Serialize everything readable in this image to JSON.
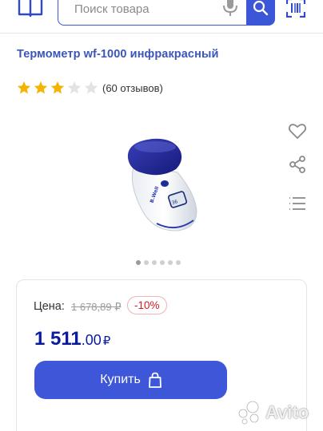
{
  "header": {
    "search_placeholder": "Поиск товара",
    "icons": [
      "book-icon",
      "microphone-icon",
      "search-icon",
      "barcode-scan-icon"
    ],
    "accent_color": "#3b56d6"
  },
  "product": {
    "title": "Термометр wf-1000 инфракрасный",
    "rating_stars": 3,
    "rating_max": 5,
    "reviews": "(60 отзывов)",
    "gallery_dots": 6,
    "gallery_active_index": 0,
    "brand_on_device": "B.Well"
  },
  "actions": {
    "icons": [
      "heart-icon",
      "share-icon",
      "compare-icon"
    ]
  },
  "price": {
    "label": "Цена:",
    "old": "1 678,89 ₽",
    "discount": "-10%",
    "main_int": "1 511",
    "main_cents": ".00",
    "currency": "₽",
    "price_color": "#0a1b9e",
    "discount_color": "#d81c1c"
  },
  "buy": {
    "label": "Купить",
    "color": "#3e57d8"
  },
  "watermark": {
    "text": "Avito"
  }
}
